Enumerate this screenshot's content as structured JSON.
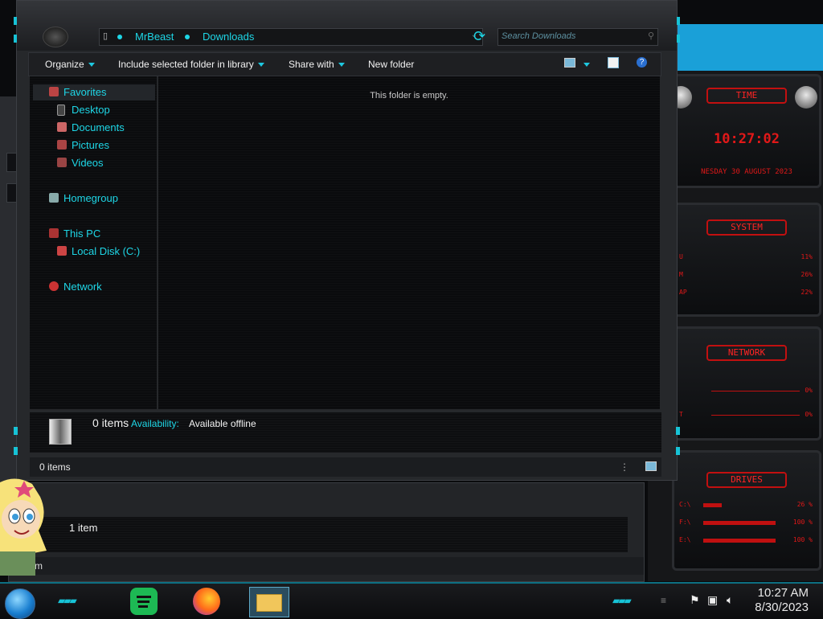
{
  "window": {
    "breadcrumb": [
      "MrBeast",
      "Downloads"
    ],
    "search_placeholder": "Search Downloads",
    "toolbar": {
      "organize": "Organize",
      "include_library": "Include selected folder in library",
      "share_with": "Share with",
      "new_folder": "New folder"
    },
    "nav": {
      "favorites": "Favorites",
      "desktop": "Desktop",
      "documents": "Documents",
      "pictures": "Pictures",
      "videos": "Videos",
      "homegroup": "Homegroup",
      "this_pc": "This PC",
      "local_disk": "Local Disk (C:)",
      "network": "Network"
    },
    "empty_message": "This folder is empty.",
    "details": {
      "count": "0 items",
      "availability_label": "Availability:",
      "availability_value": "Available offline"
    },
    "status": "0 items"
  },
  "window2": {
    "details_count": "1 item",
    "status_fragment": "m"
  },
  "gadgets": {
    "time": {
      "title": "TIME",
      "clock": "10:27:02",
      "date": "NESDAY 30 AUGUST 2023"
    },
    "system": {
      "title": "SYSTEM",
      "rows": [
        {
          "label": "U",
          "value": "11%",
          "level": 0.11
        },
        {
          "label": "M",
          "value": "26%",
          "level": 0.26
        },
        {
          "label": "AP",
          "value": "22%",
          "level": 0.22
        }
      ]
    },
    "network": {
      "title": "NETWORK",
      "rows": [
        {
          "label": "",
          "value": "0%"
        },
        {
          "label": "T",
          "value": "0%"
        }
      ]
    },
    "drives": {
      "title": "DRIVES",
      "rows": [
        {
          "label": "C:\\",
          "value": "26 %",
          "level": 0.26
        },
        {
          "label": "F:\\",
          "value": "100 %",
          "level": 1.0
        },
        {
          "label": "E:\\",
          "value": "100 %",
          "level": 1.0
        }
      ]
    }
  },
  "taskbar": {
    "apps": [
      "spotify-icon",
      "firefox-icon",
      "file-explorer-icon"
    ],
    "time": "10:27 AM",
    "date": "8/30/2023"
  },
  "colors": {
    "accent": "#1ed6e6",
    "gadget_red": "#e01818",
    "window_bg": "#26282b"
  }
}
